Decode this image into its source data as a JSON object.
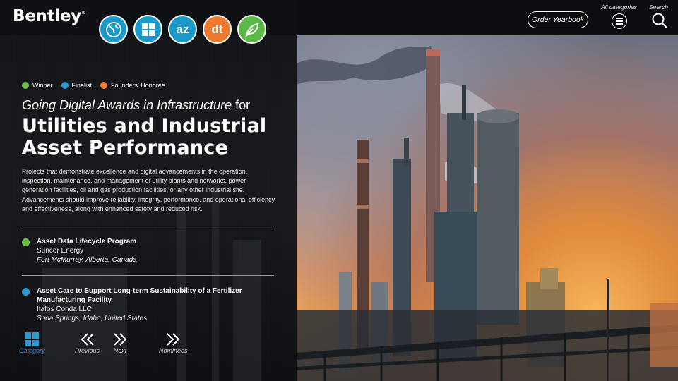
{
  "brand": {
    "name": "Bentley",
    "trademark": "®"
  },
  "category_icons": [
    {
      "name": "globe-icon",
      "color": "#1b9ac9"
    },
    {
      "name": "grid-icon",
      "color": "#1b9ac9"
    },
    {
      "name": "az-icon",
      "color": "#1b9ac9",
      "text": "az"
    },
    {
      "name": "dt-icon",
      "color": "#ee7a2f",
      "text": "dt"
    },
    {
      "name": "leaf-icon",
      "color": "#5cb947"
    }
  ],
  "header": {
    "order_yearbook": "Order Yearbook",
    "all_categories": "All categories",
    "search": "Search"
  },
  "legend": [
    {
      "label": "Winner",
      "color": "#6cbd45"
    },
    {
      "label": "Finalist",
      "color": "#2a9ad1"
    },
    {
      "label": "Founders' Honoree",
      "color": "#ee7a2f"
    }
  ],
  "subtitle": {
    "italic": "Going Digital Awards in Infrastructure",
    "suffix": " for"
  },
  "title": {
    "line1": "Utilities and Industrial",
    "line2": "Asset Performance"
  },
  "description": "Projects that demonstrate excellence and digital advancements in the operation, inspection, maintenance, and management of utility plants and networks, power generation facilities, oil and gas production facilities, or any other industrial site. Advancements should improve reliability, integrity, performance, and operational efficiency and effectiveness, along with enhanced safety and reduced risk.",
  "entries": [
    {
      "status": "Winner",
      "color": "#6cbd45",
      "title": "Asset Data Lifecycle Program",
      "organization": "Suncor Energy",
      "location": "Fort McMurray, Alberta, Canada"
    },
    {
      "status": "Finalist",
      "color": "#2a9ad1",
      "title": "Asset Care to Support Long-term Sustainability of a Fertilizer Manufacturing Facility",
      "organization": "Itafos Conda LLC",
      "location": "Soda Springs, Idaho, United States"
    }
  ],
  "nav": {
    "category": "Category",
    "previous": "Previous",
    "next": "Next",
    "nominees": "Nominees",
    "category_color": "#2a9ad1"
  }
}
